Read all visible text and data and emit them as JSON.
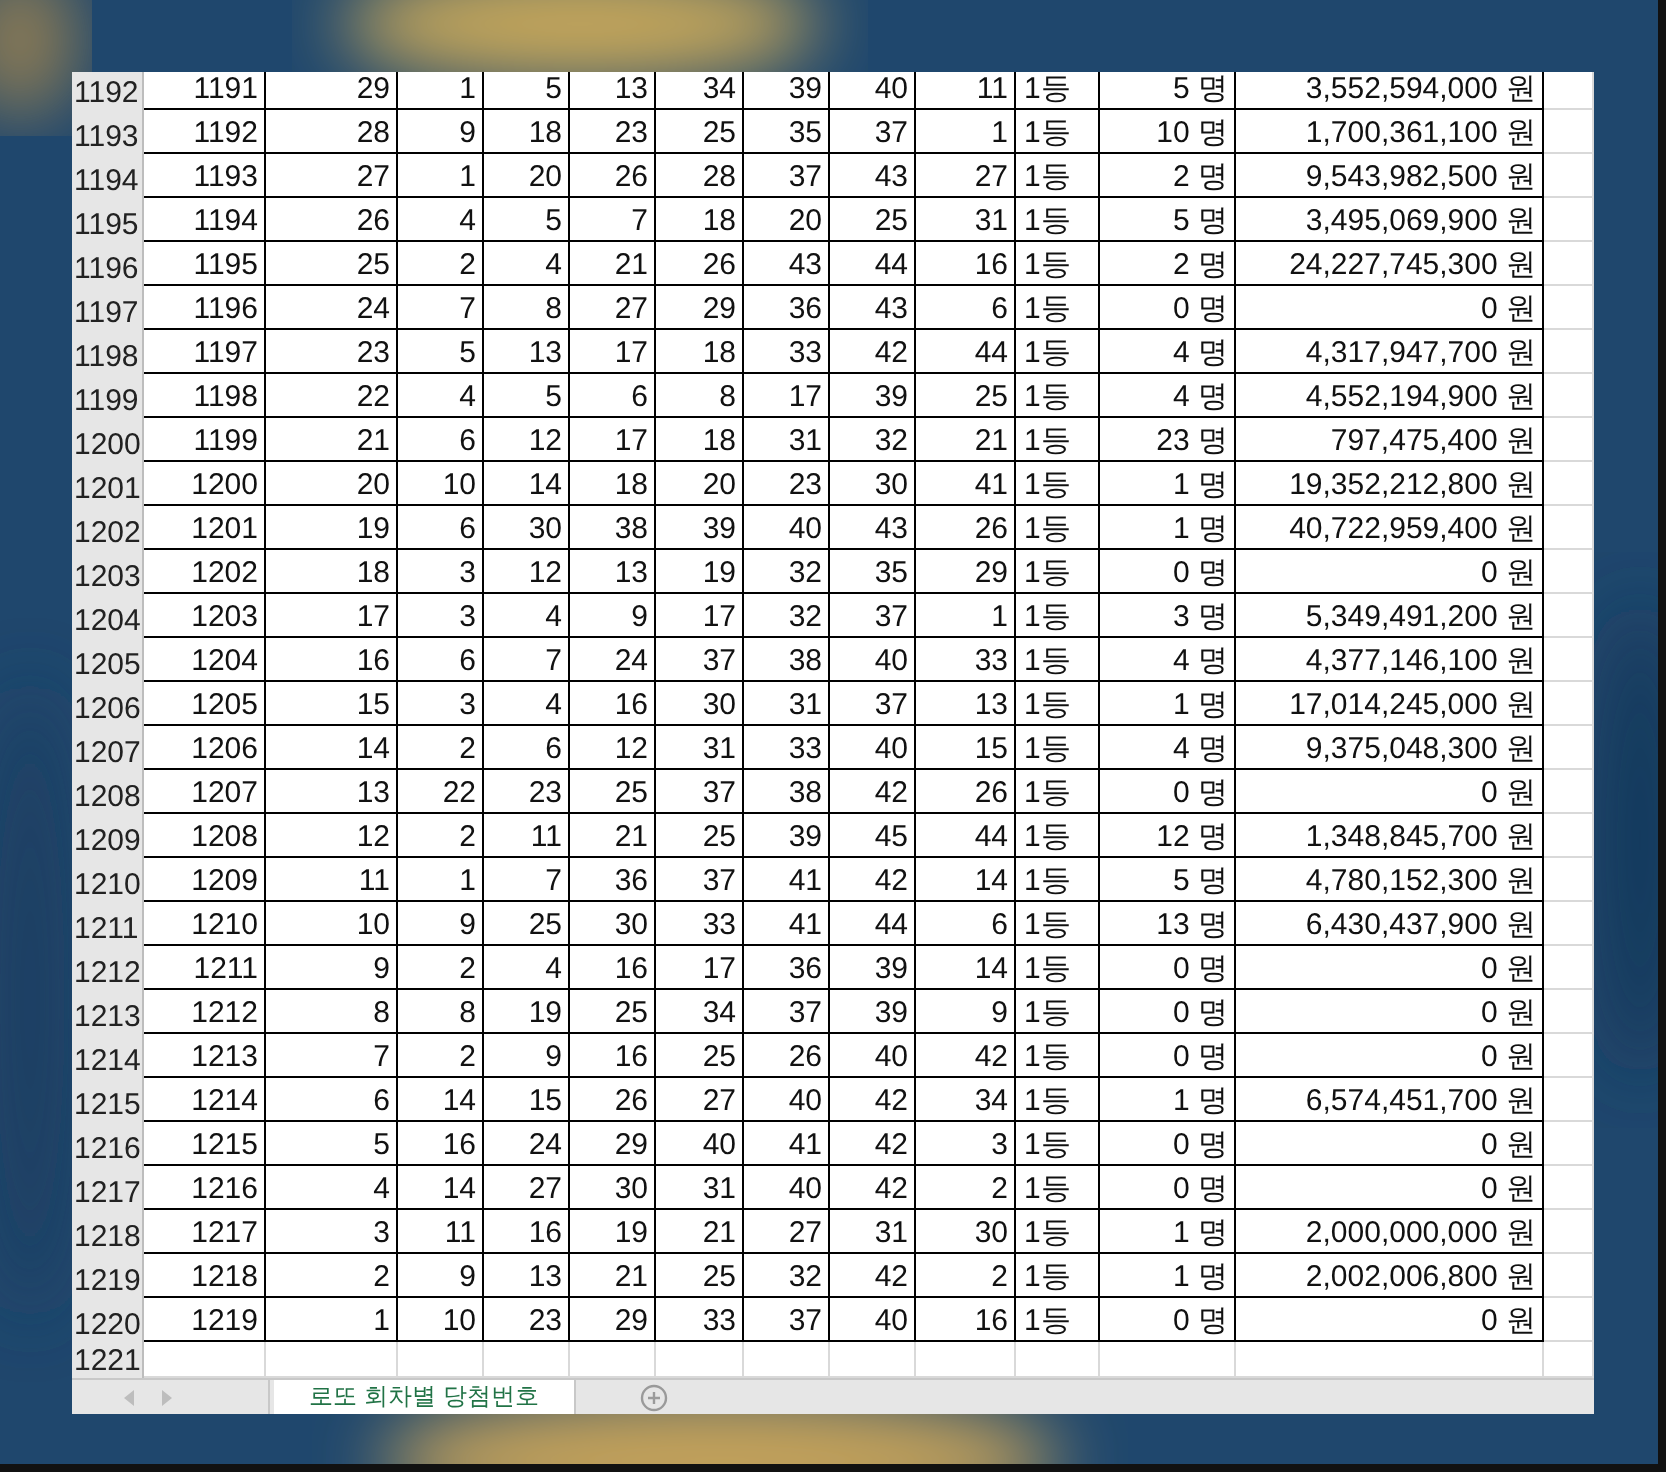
{
  "sheet": {
    "rows": [
      {
        "header": "1192",
        "cells": [
          "1191",
          "29",
          "1",
          "5",
          "13",
          "34",
          "39",
          "40",
          "11",
          "1등",
          "5 명",
          "3,552,594,000 원"
        ]
      },
      {
        "header": "1193",
        "cells": [
          "1192",
          "28",
          "9",
          "18",
          "23",
          "25",
          "35",
          "37",
          "1",
          "1등",
          "10 명",
          "1,700,361,100 원"
        ]
      },
      {
        "header": "1194",
        "cells": [
          "1193",
          "27",
          "1",
          "20",
          "26",
          "28",
          "37",
          "43",
          "27",
          "1등",
          "2 명",
          "9,543,982,500 원"
        ]
      },
      {
        "header": "1195",
        "cells": [
          "1194",
          "26",
          "4",
          "5",
          "7",
          "18",
          "20",
          "25",
          "31",
          "1등",
          "5 명",
          "3,495,069,900 원"
        ]
      },
      {
        "header": "1196",
        "cells": [
          "1195",
          "25",
          "2",
          "4",
          "21",
          "26",
          "43",
          "44",
          "16",
          "1등",
          "2 명",
          "24,227,745,300 원"
        ]
      },
      {
        "header": "1197",
        "cells": [
          "1196",
          "24",
          "7",
          "8",
          "27",
          "29",
          "36",
          "43",
          "6",
          "1등",
          "0 명",
          "0 원"
        ]
      },
      {
        "header": "1198",
        "cells": [
          "1197",
          "23",
          "5",
          "13",
          "17",
          "18",
          "33",
          "42",
          "44",
          "1등",
          "4 명",
          "4,317,947,700 원"
        ]
      },
      {
        "header": "1199",
        "cells": [
          "1198",
          "22",
          "4",
          "5",
          "6",
          "8",
          "17",
          "39",
          "25",
          "1등",
          "4 명",
          "4,552,194,900 원"
        ]
      },
      {
        "header": "1200",
        "cells": [
          "1199",
          "21",
          "6",
          "12",
          "17",
          "18",
          "31",
          "32",
          "21",
          "1등",
          "23 명",
          "797,475,400 원"
        ]
      },
      {
        "header": "1201",
        "cells": [
          "1200",
          "20",
          "10",
          "14",
          "18",
          "20",
          "23",
          "30",
          "41",
          "1등",
          "1 명",
          "19,352,212,800 원"
        ]
      },
      {
        "header": "1202",
        "cells": [
          "1201",
          "19",
          "6",
          "30",
          "38",
          "39",
          "40",
          "43",
          "26",
          "1등",
          "1 명",
          "40,722,959,400 원"
        ]
      },
      {
        "header": "1203",
        "cells": [
          "1202",
          "18",
          "3",
          "12",
          "13",
          "19",
          "32",
          "35",
          "29",
          "1등",
          "0 명",
          "0 원"
        ]
      },
      {
        "header": "1204",
        "cells": [
          "1203",
          "17",
          "3",
          "4",
          "9",
          "17",
          "32",
          "37",
          "1",
          "1등",
          "3 명",
          "5,349,491,200 원"
        ]
      },
      {
        "header": "1205",
        "cells": [
          "1204",
          "16",
          "6",
          "7",
          "24",
          "37",
          "38",
          "40",
          "33",
          "1등",
          "4 명",
          "4,377,146,100 원"
        ]
      },
      {
        "header": "1206",
        "cells": [
          "1205",
          "15",
          "3",
          "4",
          "16",
          "30",
          "31",
          "37",
          "13",
          "1등",
          "1 명",
          "17,014,245,000 원"
        ]
      },
      {
        "header": "1207",
        "cells": [
          "1206",
          "14",
          "2",
          "6",
          "12",
          "31",
          "33",
          "40",
          "15",
          "1등",
          "4 명",
          "9,375,048,300 원"
        ]
      },
      {
        "header": "1208",
        "cells": [
          "1207",
          "13",
          "22",
          "23",
          "25",
          "37",
          "38",
          "42",
          "26",
          "1등",
          "0 명",
          "0 원"
        ]
      },
      {
        "header": "1209",
        "cells": [
          "1208",
          "12",
          "2",
          "11",
          "21",
          "25",
          "39",
          "45",
          "44",
          "1등",
          "12 명",
          "1,348,845,700 원"
        ]
      },
      {
        "header": "1210",
        "cells": [
          "1209",
          "11",
          "1",
          "7",
          "36",
          "37",
          "41",
          "42",
          "14",
          "1등",
          "5 명",
          "4,780,152,300 원"
        ]
      },
      {
        "header": "1211",
        "cells": [
          "1210",
          "10",
          "9",
          "25",
          "30",
          "33",
          "41",
          "44",
          "6",
          "1등",
          "13 명",
          "6,430,437,900 원"
        ]
      },
      {
        "header": "1212",
        "cells": [
          "1211",
          "9",
          "2",
          "4",
          "16",
          "17",
          "36",
          "39",
          "14",
          "1등",
          "0 명",
          "0 원"
        ]
      },
      {
        "header": "1213",
        "cells": [
          "1212",
          "8",
          "8",
          "19",
          "25",
          "34",
          "37",
          "39",
          "9",
          "1등",
          "0 명",
          "0 원"
        ]
      },
      {
        "header": "1214",
        "cells": [
          "1213",
          "7",
          "2",
          "9",
          "16",
          "25",
          "26",
          "40",
          "42",
          "1등",
          "0 명",
          "0 원"
        ]
      },
      {
        "header": "1215",
        "cells": [
          "1214",
          "6",
          "14",
          "15",
          "26",
          "27",
          "40",
          "42",
          "34",
          "1등",
          "1 명",
          "6,574,451,700 원"
        ]
      },
      {
        "header": "1216",
        "cells": [
          "1215",
          "5",
          "16",
          "24",
          "29",
          "40",
          "41",
          "42",
          "3",
          "1등",
          "0 명",
          "0 원"
        ]
      },
      {
        "header": "1217",
        "cells": [
          "1216",
          "4",
          "14",
          "27",
          "30",
          "31",
          "40",
          "42",
          "2",
          "1등",
          "0 명",
          "0 원"
        ]
      },
      {
        "header": "1218",
        "cells": [
          "1217",
          "3",
          "11",
          "16",
          "19",
          "21",
          "27",
          "31",
          "30",
          "1등",
          "1 명",
          "2,000,000,000 원"
        ]
      },
      {
        "header": "1219",
        "cells": [
          "1218",
          "2",
          "9",
          "13",
          "21",
          "25",
          "32",
          "42",
          "2",
          "1등",
          "1 명",
          "2,002,006,800 원"
        ]
      },
      {
        "header": "1220",
        "cells": [
          "1219",
          "1",
          "10",
          "23",
          "29",
          "33",
          "37",
          "40",
          "16",
          "1등",
          "0 명",
          "0 원"
        ]
      },
      {
        "header": "1221"
      }
    ],
    "tabs": [
      {
        "label": "로또 회차별 당첨번호",
        "selected": true
      }
    ]
  }
}
